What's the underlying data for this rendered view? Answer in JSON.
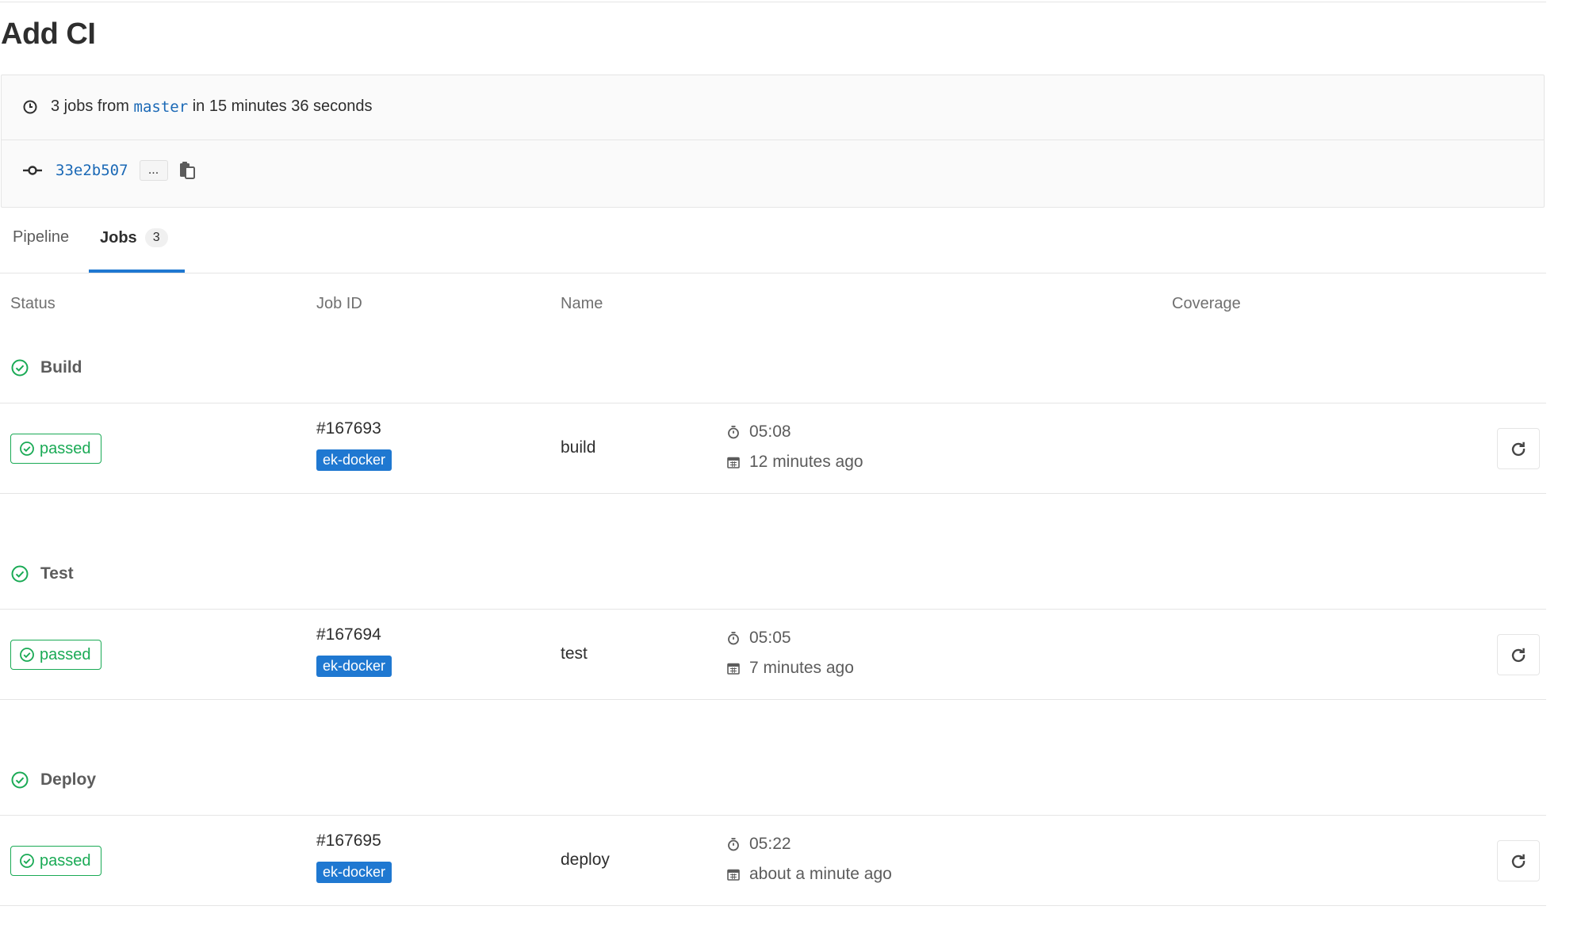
{
  "page": {
    "title": "Add CI"
  },
  "summary": {
    "prefix": "3 jobs from",
    "ref": "master",
    "suffix": "in 15 minutes 36 seconds",
    "icon": "clock-icon"
  },
  "commit": {
    "sha": "33e2b507",
    "ellipsis": "...",
    "icon": "commit-icon",
    "copy_icon": "clipboard-icon"
  },
  "tabs": [
    {
      "label": "Pipeline",
      "active": false
    },
    {
      "label": "Jobs",
      "count": "3",
      "active": true
    }
  ],
  "table": {
    "columns": [
      "Status",
      "Job ID",
      "Name",
      "Coverage"
    ]
  },
  "stages": [
    {
      "name": "Build",
      "jobs": [
        {
          "status": "passed",
          "id": "#167693",
          "runner": "ek-docker",
          "name": "build",
          "duration": "05:08",
          "finished": "12 minutes ago"
        }
      ]
    },
    {
      "name": "Test",
      "jobs": [
        {
          "status": "passed",
          "id": "#167694",
          "runner": "ek-docker",
          "name": "test",
          "duration": "05:05",
          "finished": "7 minutes ago"
        }
      ]
    },
    {
      "name": "Deploy",
      "jobs": [
        {
          "status": "passed",
          "id": "#167695",
          "runner": "ek-docker",
          "name": "deploy",
          "duration": "05:22",
          "finished": "about a minute ago"
        }
      ]
    }
  ],
  "colors": {
    "success": "#1aaa55",
    "link": "#1b69b6",
    "tag": "#1f78d1",
    "border": "#e5e5e5"
  }
}
